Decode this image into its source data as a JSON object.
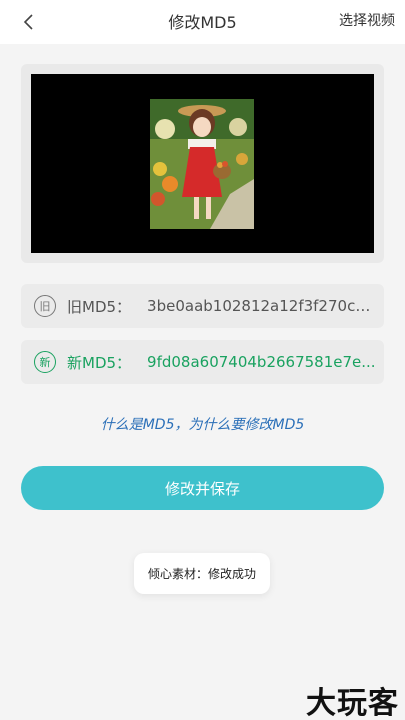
{
  "header": {
    "title": "修改MD5",
    "select_label": "选择视频"
  },
  "video": {
    "thumbnail": "girl-with-flower-basket-illustration"
  },
  "md5": {
    "old_badge": "旧",
    "old_label": "旧MD5：",
    "old_value": "3be0aab102812a12f3f270c3...",
    "new_badge": "新",
    "new_label": "新MD5：",
    "new_value": "9fd08a607404b2667581e7e..."
  },
  "help_link": "什么是MD5，为什么要修改MD5",
  "save_button": "修改并保存",
  "toast": "倾心素材：修改成功",
  "watermark": "大玩客",
  "colors": {
    "accent": "#3ec1cc",
    "new_green": "#1aa260",
    "link_blue": "#2a6fb8"
  }
}
